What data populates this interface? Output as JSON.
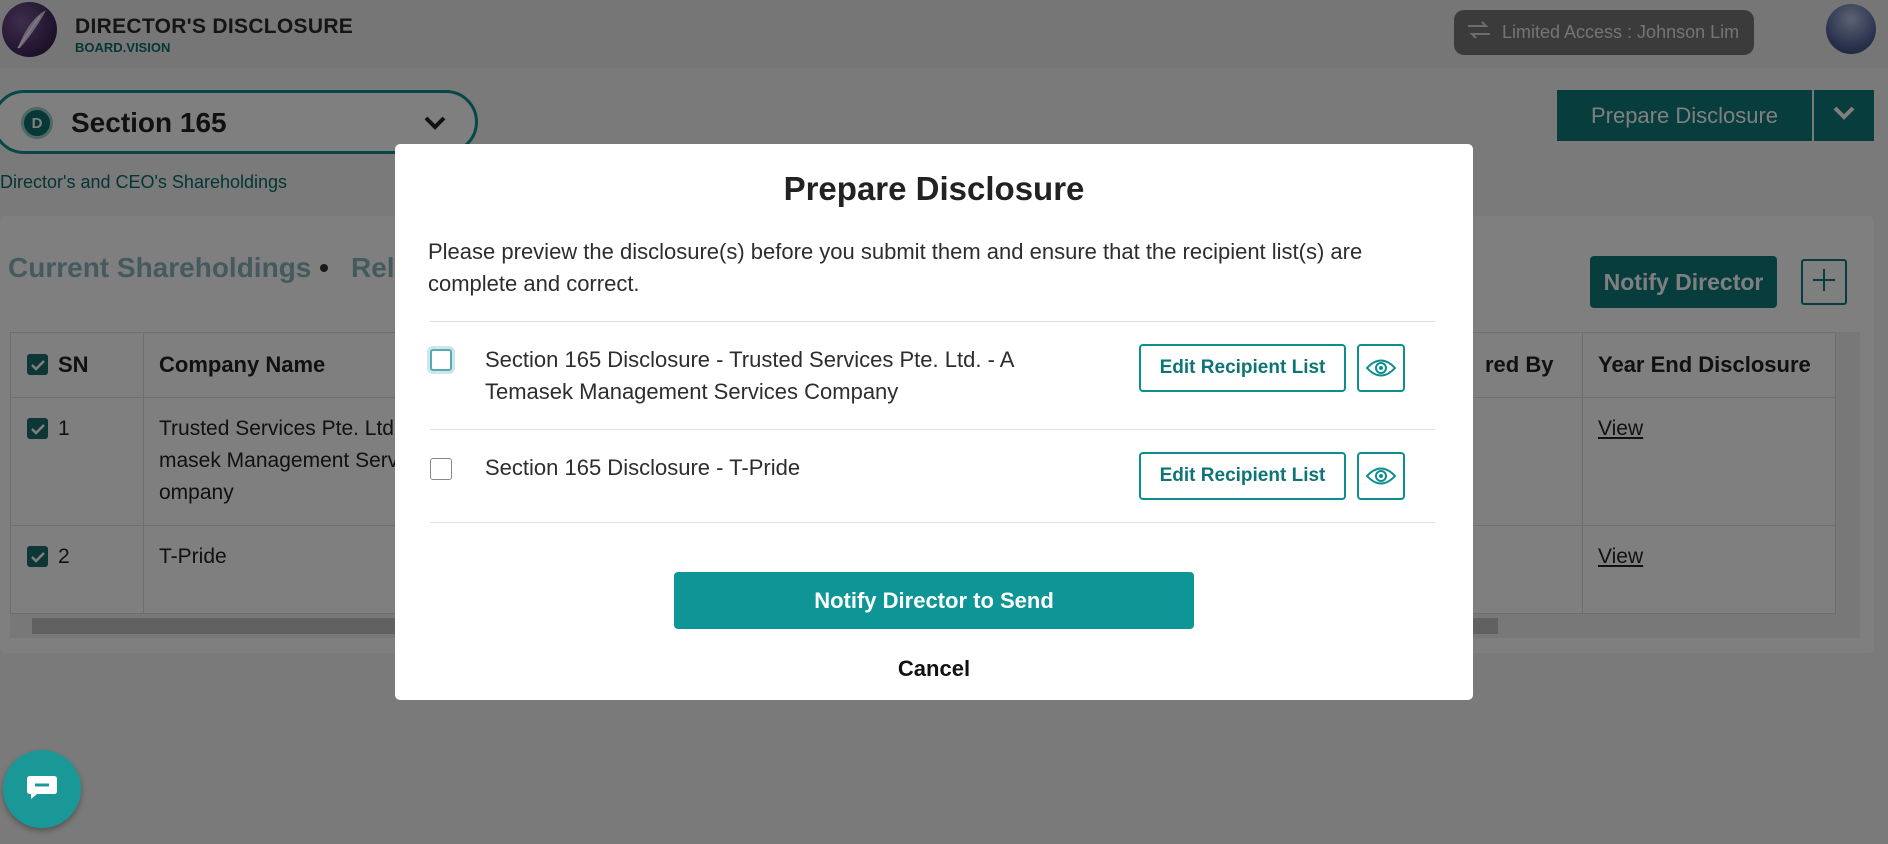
{
  "header": {
    "app_title": "DIRECTOR'S DISCLOSURE",
    "app_subtitle": "BOARD.VISION",
    "access_label": "Limited Access : Johnson Lim"
  },
  "section": {
    "badge": "D",
    "title": "Section 165",
    "description": "Director's and CEO's Shareholdings"
  },
  "toolbar": {
    "prepare_label": "Prepare Disclosure",
    "notify_director_label": "Notify Director"
  },
  "tabs": {
    "current": "Current Shareholdings",
    "related": "Rel"
  },
  "table": {
    "headers": {
      "sn": "SN",
      "company": "Company Name",
      "prepared_by": "red By",
      "year_end": "Year End Disclosure"
    },
    "rows": [
      {
        "sn": "1",
        "company_line1": "Trusted Services Pte. Ltd.",
        "company_line2": "masek Management Serv",
        "company_line3": "ompany",
        "year_end": "View"
      },
      {
        "sn": "2",
        "company_line1": "T-Pride",
        "company_line2": "",
        "company_line3": "",
        "year_end": "View"
      }
    ]
  },
  "modal": {
    "title": "Prepare Disclosure",
    "message": "Please preview the disclosure(s) before you submit them and ensure that the recipient list(s) are complete and correct.",
    "items": [
      {
        "label": "Section 165 Disclosure - Trusted Services Pte. Ltd. - A Temasek Management Services Company",
        "edit_label": "Edit Recipient List",
        "checked": false
      },
      {
        "label": "Section 165 Disclosure - T-Pride",
        "edit_label": "Edit Recipient List",
        "checked": false
      }
    ],
    "send_label": "Notify Director to Send",
    "cancel_label": "Cancel"
  },
  "colors": {
    "accent": "#0e7a7a",
    "overlay": "rgba(0,0,0,0.5)"
  },
  "icons": [
    "feather-logo-icon",
    "switch-account-icon",
    "avatar",
    "chevron-down-icon",
    "plus-icon",
    "check-icon",
    "eye-icon",
    "chat-icon"
  ]
}
